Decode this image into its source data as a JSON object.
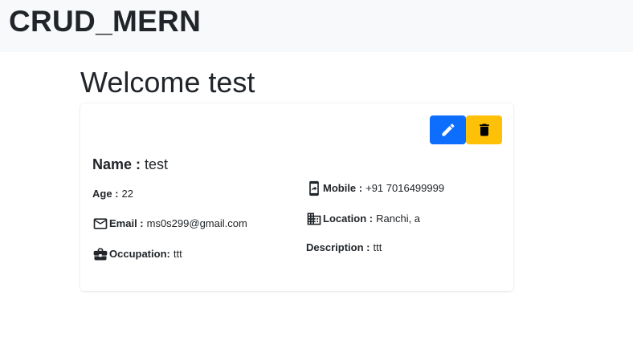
{
  "navbar": {
    "brand": "CRUD_MERN"
  },
  "page": {
    "welcome": "Welcome test"
  },
  "card": {
    "name_label": "Name :",
    "name_value": "test",
    "age_label": "Age :",
    "age_value": "22",
    "email_label": "Email :",
    "email_value": "ms0s299@gmail.com",
    "occupation_label": "Occupation:",
    "occupation_value": "ttt",
    "mobile_label": "Mobile :",
    "mobile_value": "+91 7016499999",
    "location_label": "Location :",
    "location_value": "Ranchi, a",
    "description_label": "Description :",
    "description_value": "ttt",
    "icons": {
      "edit": "pencil-icon",
      "delete": "trash-icon",
      "email": "mail-icon",
      "occupation": "briefcase-icon",
      "mobile": "phone-icon",
      "location": "building-icon"
    }
  },
  "colors": {
    "edit_button": "#0d6efd",
    "delete_button": "#ffc107",
    "navbar_bg": "#f8f9fa"
  }
}
